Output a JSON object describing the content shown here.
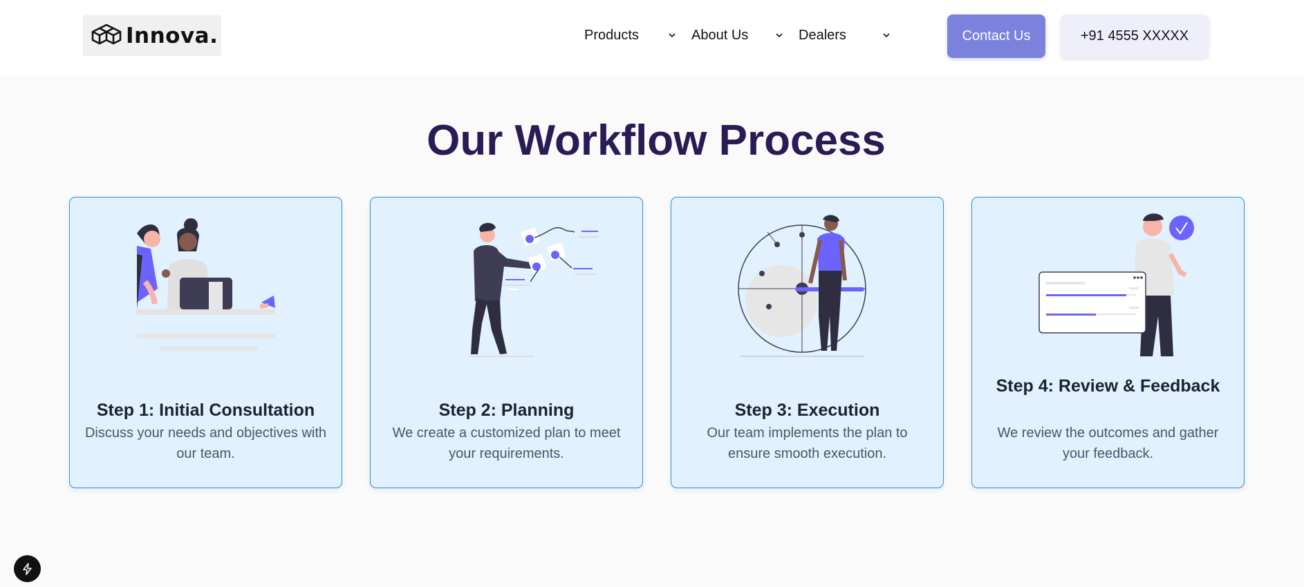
{
  "header": {
    "logo_text": "Innova.",
    "nav": [
      {
        "label": "Products"
      },
      {
        "label": "About Us"
      },
      {
        "label": "Dealers"
      }
    ],
    "contact_label": "Contact Us",
    "phone_label": "+91 4555 XXXXX"
  },
  "main": {
    "title": "Our Workflow Process",
    "steps": [
      {
        "title": "Step 1: Initial Consultation",
        "description": "Discuss your needs and objectives with our team.",
        "illustration": "consultation-illustration"
      },
      {
        "title": "Step 2: Planning",
        "description": "We create a customized plan to meet your requirements.",
        "illustration": "planning-illustration"
      },
      {
        "title": "Step 3: Execution",
        "description": "Our team implements the plan to ensure smooth execution.",
        "illustration": "execution-illustration"
      },
      {
        "title": "Step 4: Review & Feedback",
        "description": "We review the outcomes and gather your feedback.",
        "illustration": "review-illustration"
      }
    ]
  },
  "colors": {
    "accent": "#7b82de",
    "illustration_accent": "#6c63ff",
    "title": "#2a1b55",
    "card_bg": "#e1f1fd",
    "card_border": "#2f8fd8"
  },
  "floating": {
    "icon": "lightning-bolt-icon"
  }
}
